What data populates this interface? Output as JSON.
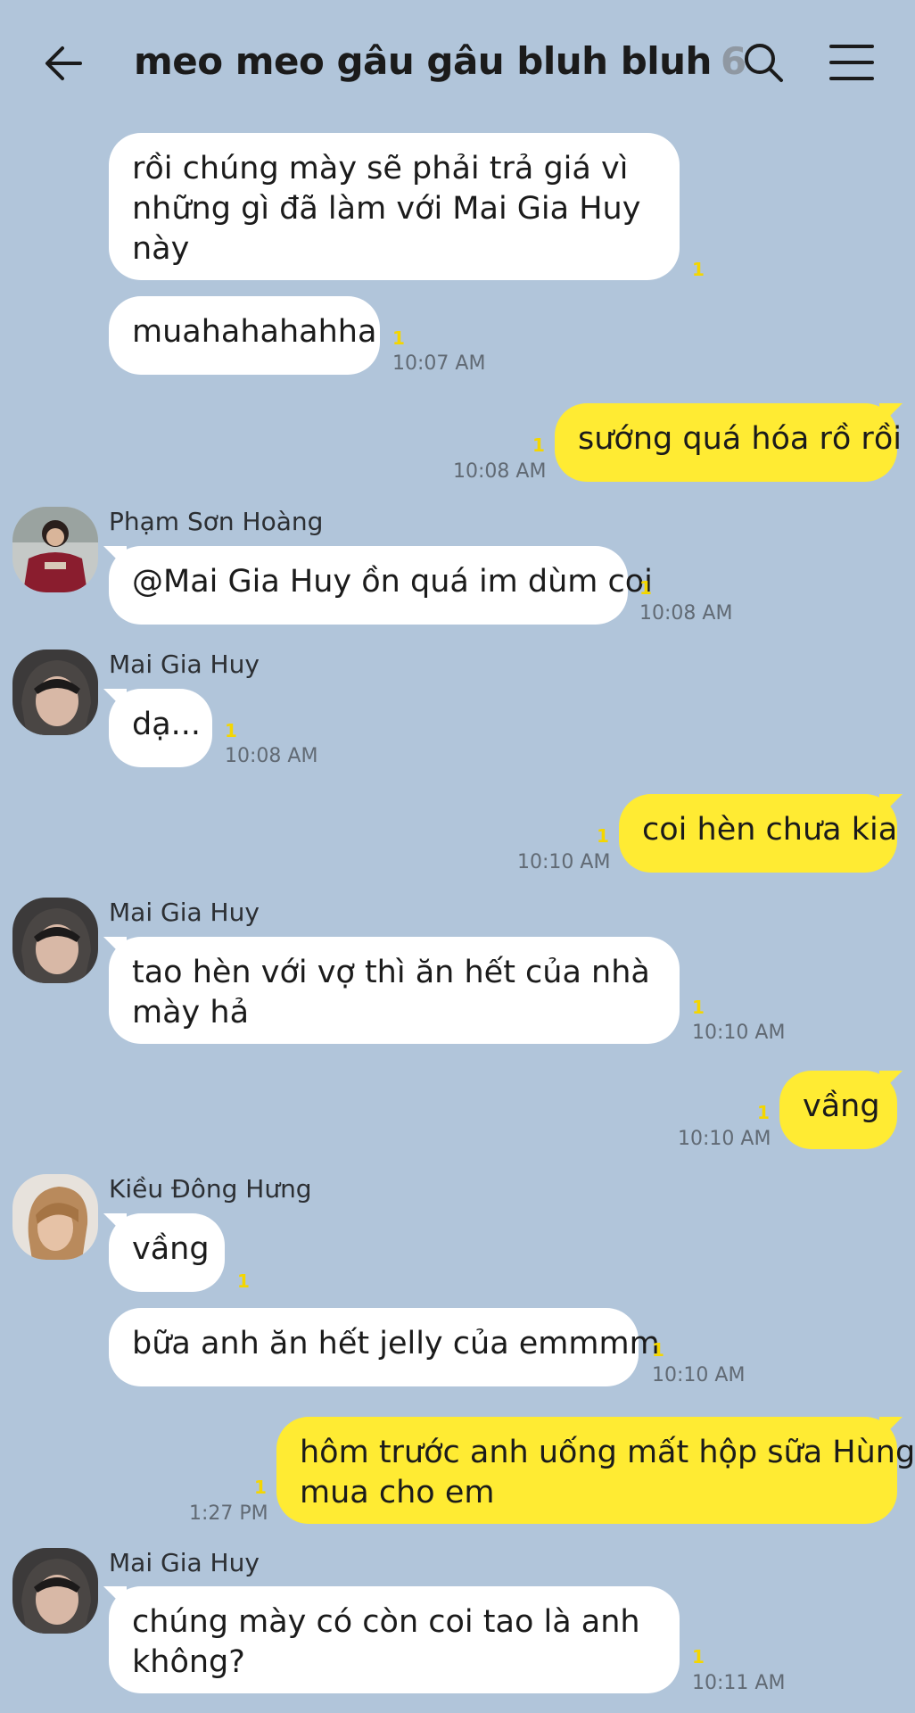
{
  "header": {
    "title": "meo meo gâu gâu bluh bluh",
    "member_count": "6",
    "back_icon": "arrow-left-icon",
    "search_icon": "search-icon",
    "menu_icon": "hamburger-menu-icon"
  },
  "colors": {
    "background": "#b1c5da",
    "my_bubble": "#ffeb33",
    "their_bubble": "#ffffff",
    "unread": "#f4d600"
  },
  "messages": [
    {
      "from": "other",
      "lines": [
        "rồi chúng mày sẽ phải trả giá vì",
        "những gì đã làm với Mai Gia Huy",
        "này"
      ],
      "unread": "1",
      "time": ""
    },
    {
      "from": "other",
      "lines": [
        "muahahahahha"
      ],
      "unread": "1",
      "time": "10:07 AM"
    },
    {
      "from": "me",
      "lines": [
        "sướng quá hóa rồ rồi"
      ],
      "unread": "1",
      "time": "10:08 AM"
    },
    {
      "from": "other",
      "sender": "Phạm Sơn Hoàng",
      "lines": [
        "@Mai Gia Huy ồn quá im dùm coi"
      ],
      "unread": "1",
      "time": "10:08 AM"
    },
    {
      "from": "other",
      "sender": "Mai Gia Huy",
      "lines": [
        "dạ..."
      ],
      "unread": "1",
      "time": "10:08 AM"
    },
    {
      "from": "me",
      "lines": [
        "coi hèn chưa kia"
      ],
      "unread": "1",
      "time": "10:10 AM"
    },
    {
      "from": "other",
      "sender": "Mai Gia Huy",
      "lines": [
        "tao hèn với vợ thì ăn hết của nhà",
        "mày hả"
      ],
      "unread": "1",
      "time": "10:10 AM"
    },
    {
      "from": "me",
      "lines": [
        "vầng"
      ],
      "unread": "1",
      "time": "10:10 AM"
    },
    {
      "from": "other",
      "sender": "Kiều Đông Hưng",
      "lines": [
        "vầng"
      ],
      "unread": "1",
      "time": ""
    },
    {
      "from": "other",
      "lines": [
        "bữa anh ăn hết jelly của emmmm"
      ],
      "unread": "1",
      "time": "10:10 AM"
    },
    {
      "from": "me",
      "lines": [
        "hôm trước anh uống mất hộp sữa Hùng",
        "mua cho em"
      ],
      "unread": "1",
      "time": "1:27 PM"
    },
    {
      "from": "other",
      "sender": "Mai Gia Huy",
      "lines": [
        "chúng mày có còn coi tao là anh",
        "không?"
      ],
      "unread": "1",
      "time": "10:11 AM"
    }
  ]
}
